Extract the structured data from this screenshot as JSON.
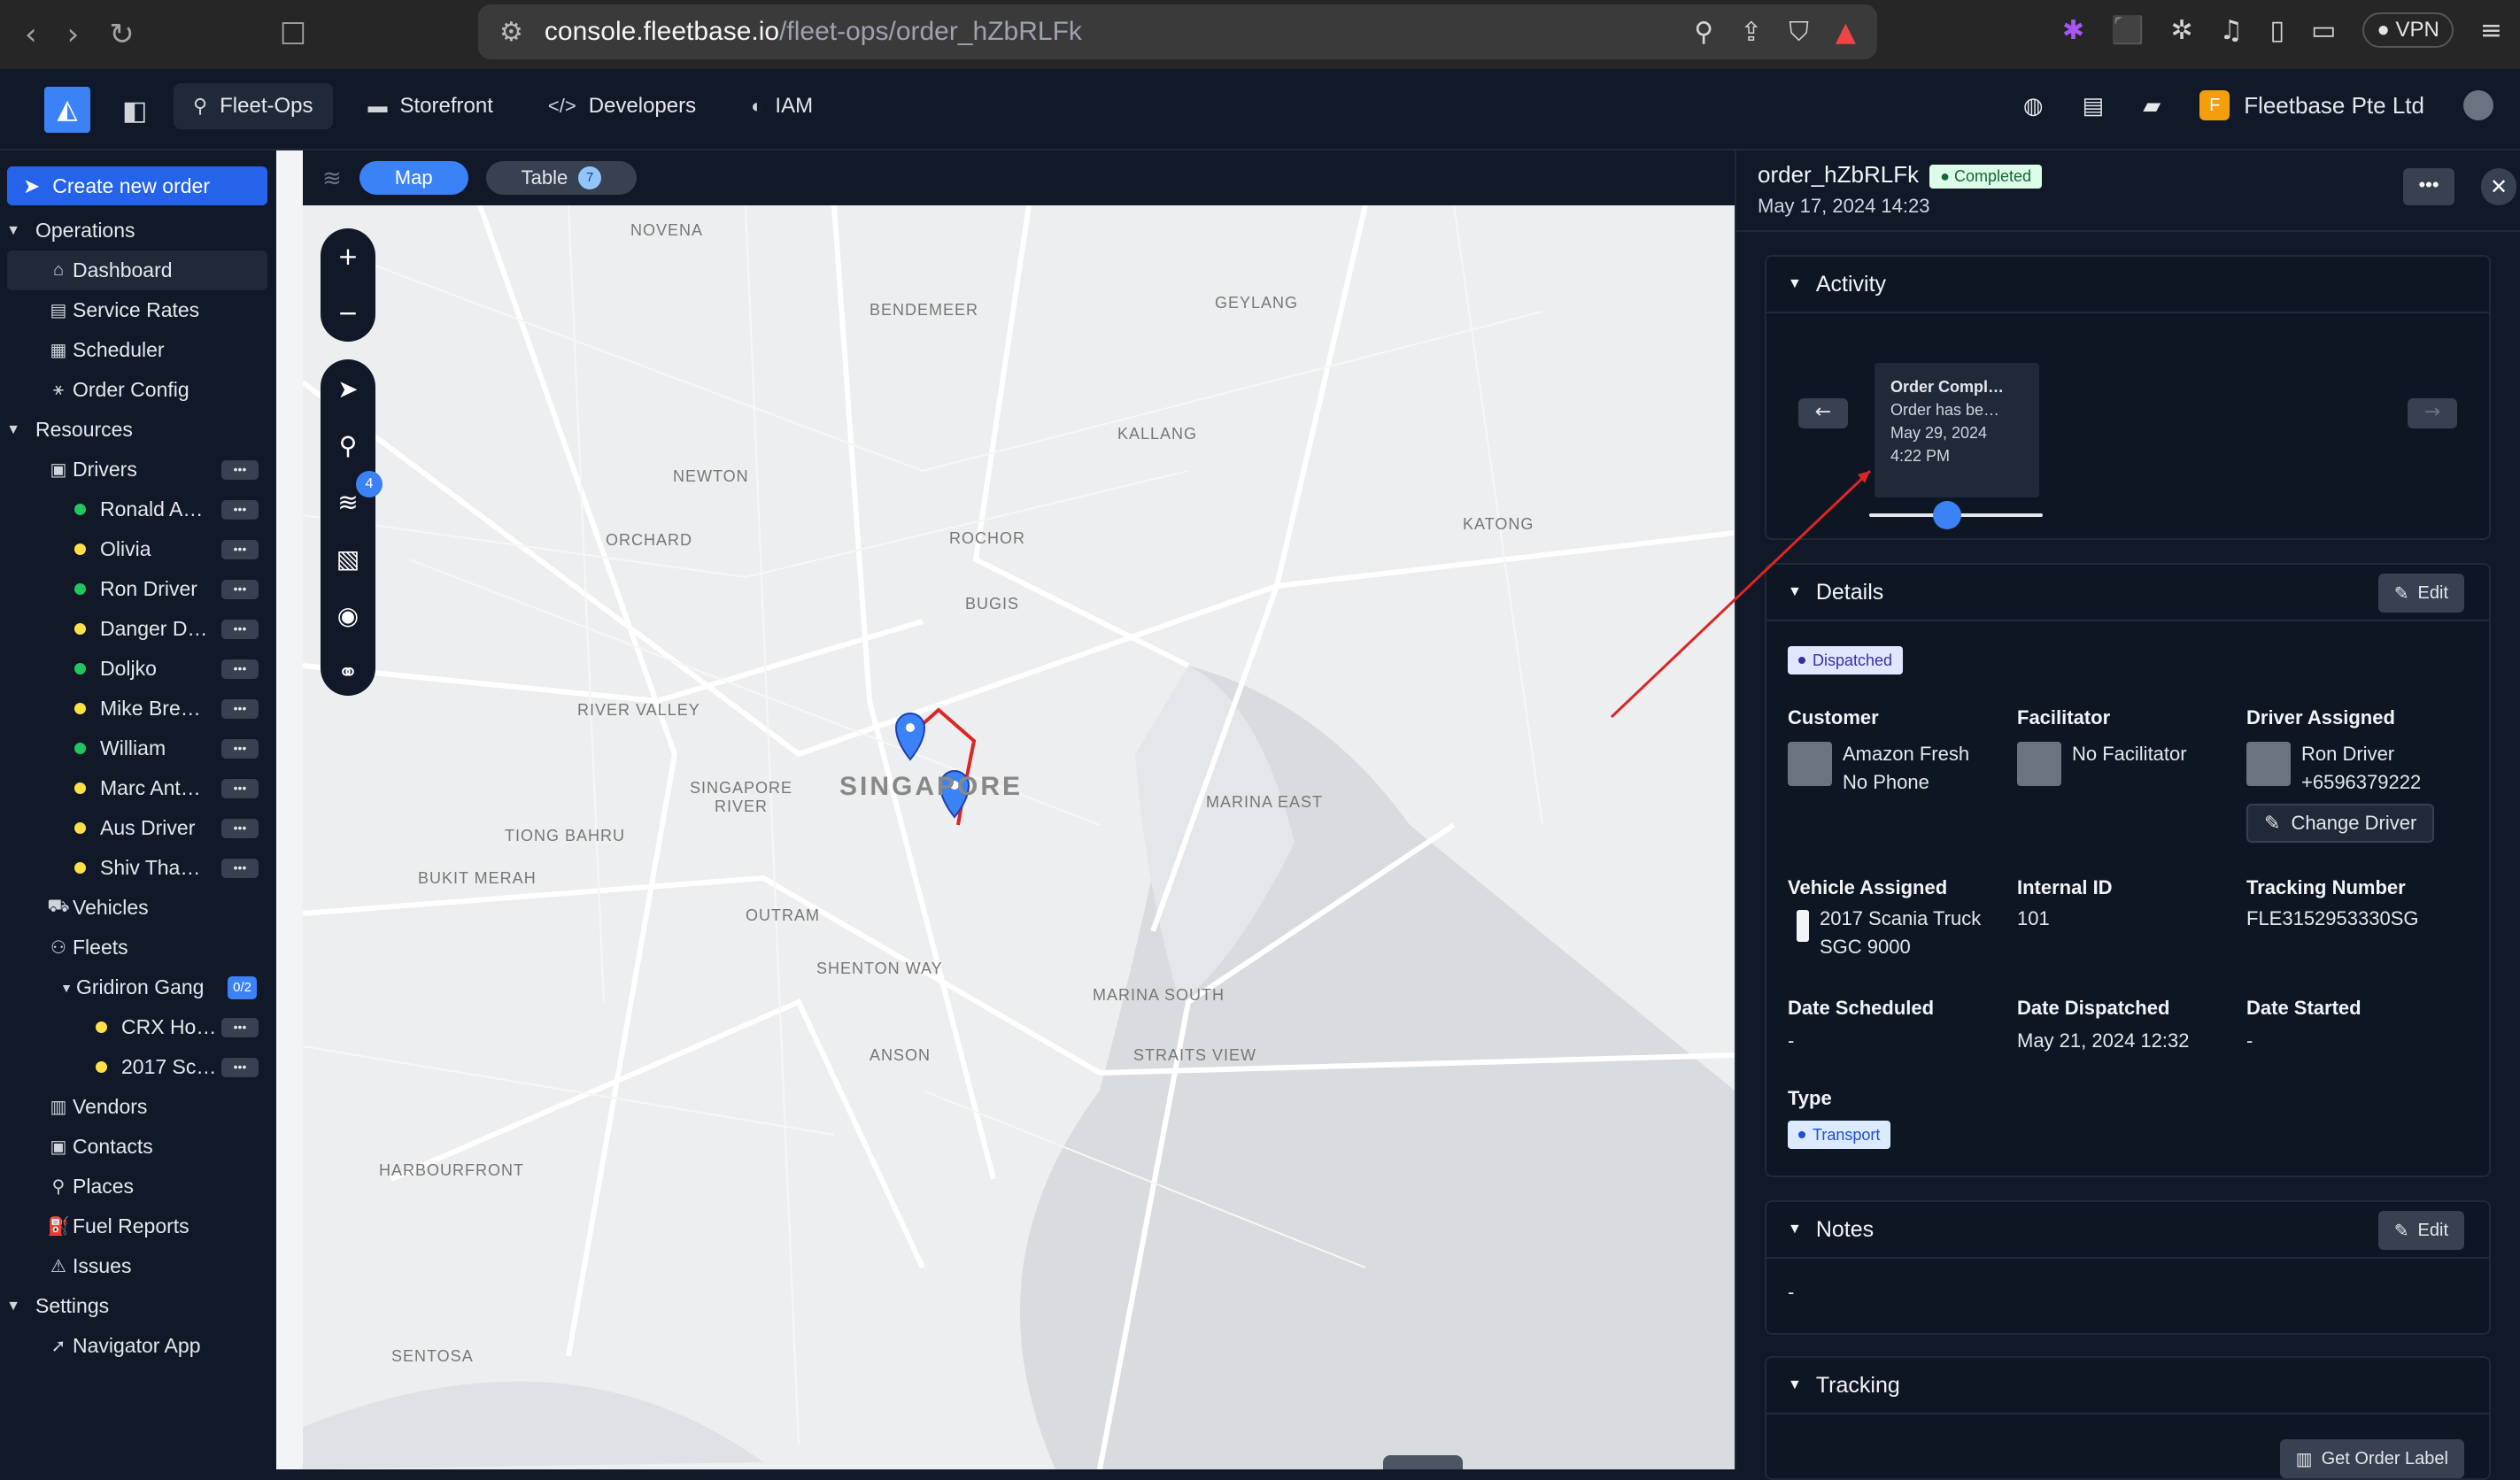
{
  "browser": {
    "url_host": "console.fleetbase.io",
    "url_path": "/fleet-ops/order_hZbRLFk",
    "vpn_label": "VPN"
  },
  "header": {
    "tabs": [
      {
        "label": "Fleet-Ops",
        "icon": "route-icon"
      },
      {
        "label": "Storefront",
        "icon": "store-icon"
      },
      {
        "label": "Developers",
        "icon": "code-icon"
      },
      {
        "label": "IAM",
        "icon": "shield-icon"
      }
    ],
    "org_initial": "F",
    "org_name": "Fleetbase Pte Ltd",
    "colors": {
      "accent": "#3b82f6",
      "org": "#f59e0b"
    }
  },
  "sidebar": {
    "create_label": "Create new order",
    "operations_label": "Operations",
    "operations": [
      "Dashboard",
      "Service Rates",
      "Scheduler",
      "Order Config"
    ],
    "resources_label": "Resources",
    "drivers_label": "Drivers",
    "drivers": [
      {
        "name": "Ronald A…",
        "status": "online"
      },
      {
        "name": "Olivia",
        "status": "idle"
      },
      {
        "name": "Ron Driver",
        "status": "online"
      },
      {
        "name": "Danger D…",
        "status": "idle"
      },
      {
        "name": "Doljko",
        "status": "online"
      },
      {
        "name": "Mike Bre…",
        "status": "idle"
      },
      {
        "name": "William",
        "status": "online"
      },
      {
        "name": "Marc Ant…",
        "status": "idle"
      },
      {
        "name": "Aus Driver",
        "status": "idle"
      },
      {
        "name": "Shiv Tha…",
        "status": "idle"
      }
    ],
    "vehicles_label": "Vehicles",
    "fleets_label": "Fleets",
    "fleet_group": "Gridiron Gang",
    "fleet_count": "0/2",
    "fleet_vehicles": [
      "CRX Ho…",
      "2017 Sc…"
    ],
    "other": [
      "Vendors",
      "Contacts",
      "Places",
      "Fuel Reports",
      "Issues"
    ],
    "settings_label": "Settings",
    "settings": [
      "Navigator App"
    ]
  },
  "map": {
    "map_label": "Map",
    "table_label": "Table",
    "table_count": "7",
    "layer_count": "4",
    "labels": [
      {
        "text": "NOVENA",
        "big": false
      },
      {
        "text": "BENDEMEER",
        "big": false
      },
      {
        "text": "GEYLANG",
        "big": false
      },
      {
        "text": "KALLANG",
        "big": false
      },
      {
        "text": "NEWTON",
        "big": false
      },
      {
        "text": "ORCHARD",
        "big": false
      },
      {
        "text": "ROCHOR",
        "big": false
      },
      {
        "text": "KATONG",
        "big": false
      },
      {
        "text": "BUGIS",
        "big": false
      },
      {
        "text": "RIVER VALLEY",
        "big": false
      },
      {
        "text": "SINGAPORE RIVER",
        "big": false
      },
      {
        "text": "SINGAPORE",
        "big": true
      },
      {
        "text": "MARINA EAST",
        "big": false
      },
      {
        "text": "TIONG BAHRU",
        "big": false
      },
      {
        "text": "BUKIT MERAH",
        "big": false
      },
      {
        "text": "OUTRAM",
        "big": false
      },
      {
        "text": "SHENTON WAY",
        "big": false
      },
      {
        "text": "MARINA SOUTH",
        "big": false
      },
      {
        "text": "STRAITS VIEW",
        "big": false
      },
      {
        "text": "ANSON",
        "big": false
      },
      {
        "text": "HARBOURFRONT",
        "big": false
      },
      {
        "text": "SENTOSA",
        "big": false
      }
    ]
  },
  "order": {
    "id": "order_hZbRLFk",
    "status": "Completed",
    "created": "May 17, 2024 14:23",
    "activity": {
      "title": "Activity",
      "card_title": "Order Compl…",
      "card_desc": "Order has be…",
      "card_date": "May 29, 2024",
      "card_time": "4:22 PM",
      "slider_fraction": 0.45
    },
    "details": {
      "title": "Details",
      "edit_label": "Edit",
      "status_pill": "Dispatched",
      "customer_label": "Customer",
      "customer_name": "Amazon Fresh",
      "customer_phone": "No Phone",
      "facilitator_label": "Facilitator",
      "facilitator_name": "No Facilitator",
      "driver_label": "Driver Assigned",
      "driver_name": "Ron Driver",
      "driver_phone": "+6596379222",
      "change_driver_label": "Change Driver",
      "vehicle_label": "Vehicle Assigned",
      "vehicle_name": "2017 Scania Truck",
      "vehicle_plate": "SGC 9000",
      "internal_id_label": "Internal ID",
      "internal_id": "101",
      "tracking_label": "Tracking Number",
      "tracking_number": "FLE3152953330SG",
      "scheduled_label": "Date Scheduled",
      "scheduled": "-",
      "dispatched_label": "Date Dispatched",
      "dispatched": "May 21, 2024 12:32",
      "started_label": "Date Started",
      "started": "-",
      "type_label": "Type",
      "type_pill": "Transport"
    },
    "notes": {
      "title": "Notes",
      "edit_label": "Edit",
      "value": "-"
    },
    "tracking": {
      "title": "Tracking",
      "label_button": "Get Order Label"
    }
  }
}
